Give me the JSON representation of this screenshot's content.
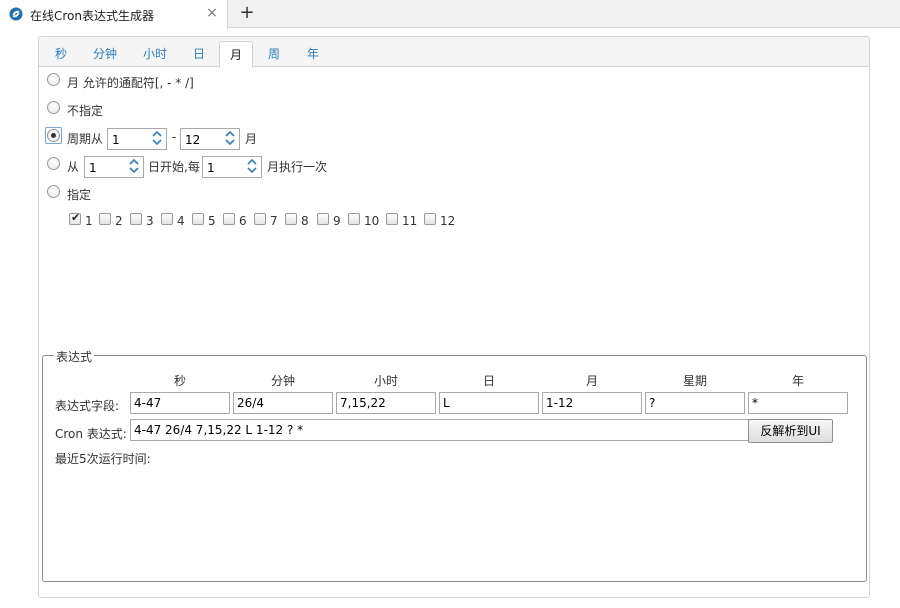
{
  "browser": {
    "tab_title": "在线Cron表达式生成器",
    "close_glyph": "×",
    "new_tab_glyph": "+"
  },
  "tabs": [
    {
      "label": "秒",
      "active": false
    },
    {
      "label": "分钟",
      "active": false
    },
    {
      "label": "小时",
      "active": false
    },
    {
      "label": "日",
      "active": false
    },
    {
      "label": "月",
      "active": true
    },
    {
      "label": "周",
      "active": false
    },
    {
      "label": "年",
      "active": false
    }
  ],
  "month_options": {
    "every": {
      "label": "月 允许的通配符[, - * /]",
      "selected": false
    },
    "unspecified": {
      "label": "不指定",
      "selected": false
    },
    "cycle": {
      "label_from": "周期从",
      "from_value": "1",
      "dash": "-",
      "to_value": "12",
      "label_unit": "月",
      "selected": true
    },
    "start": {
      "label_from": "从",
      "start_value": "1",
      "label_mid": "日开始,每",
      "every_value": "1",
      "label_end": "月执行一次",
      "selected": false
    },
    "specify": {
      "label": "指定",
      "selected": false
    },
    "months": [
      {
        "label": "1",
        "checked": true
      },
      {
        "label": "2",
        "checked": false
      },
      {
        "label": "3",
        "checked": false
      },
      {
        "label": "4",
        "checked": false
      },
      {
        "label": "5",
        "checked": false
      },
      {
        "label": "6",
        "checked": false
      },
      {
        "label": "7",
        "checked": false
      },
      {
        "label": "8",
        "checked": false
      },
      {
        "label": "9",
        "checked": false
      },
      {
        "label": "10",
        "checked": false
      },
      {
        "label": "11",
        "checked": false
      },
      {
        "label": "12",
        "checked": false
      }
    ]
  },
  "expression": {
    "legend": "表达式",
    "columns": [
      "秒",
      "分钟",
      "小时",
      "日",
      "月",
      "星期",
      "年"
    ],
    "fields_label": "表达式字段:",
    "fields": [
      "4-47",
      "26/4",
      "7,15,22",
      "L",
      "1-12",
      "?",
      "*"
    ],
    "cron_label": "Cron 表达式:",
    "cron_value": "4-47 26/4 7,15,22 L 1-12 ? *",
    "parse_button": "反解析到UI",
    "recent_label": "最近5次运行时间:"
  },
  "colors": {
    "tab_link": "#2a7fc0",
    "spinner_arrow": "#2e7fc6"
  },
  "icons": {
    "favicon": "browser-favicon-icon",
    "spin_up": "chevron-up-icon",
    "spin_down": "chevron-down-icon"
  }
}
